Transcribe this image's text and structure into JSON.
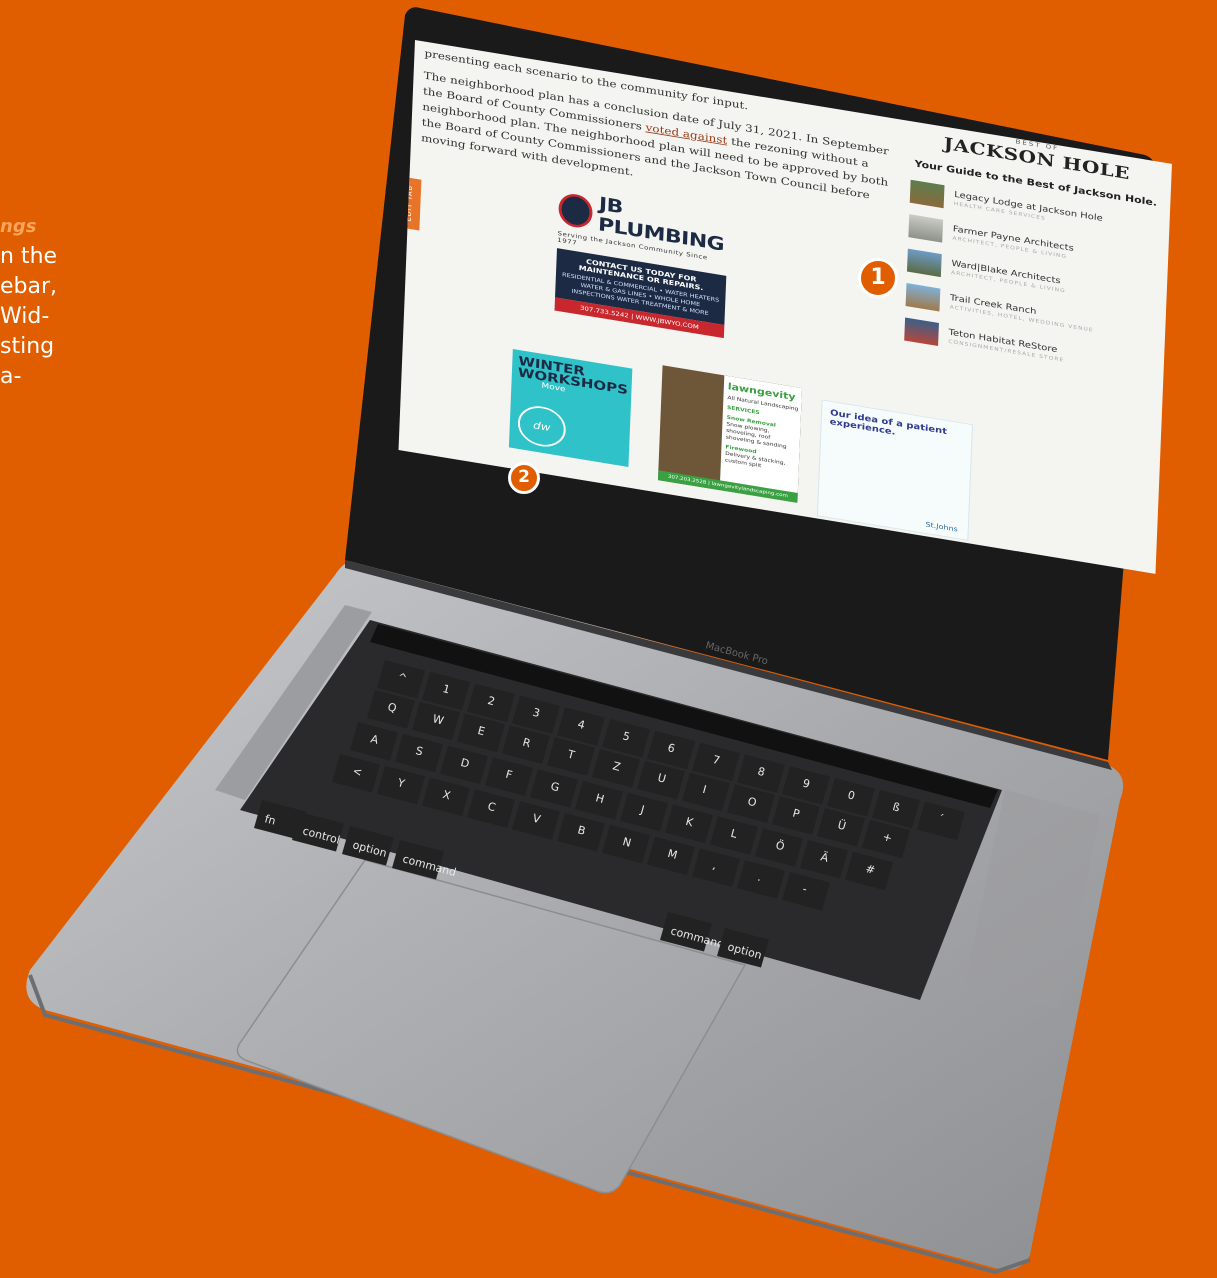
{
  "side_text": {
    "highlight": "ngs",
    "lines": [
      "n the",
      "ebar,",
      "Wid-",
      "sting",
      "a-"
    ]
  },
  "article": {
    "p1": "presenting each scenario to the community for input.",
    "p2a": "The neighborhood plan has a conclusion date of July 31, 2021. In September the Board of County Commissioners ",
    "p2_link": "voted against",
    "p2b": " the rezoning without a neighborhood plan. The neighborhood plan will need to be approved by both the Board of County Commissioners and the Jackson Town Council before moving forward with development."
  },
  "edit_tab": "EDIT TAB",
  "jb_ad": {
    "name": "JB PLUMBING",
    "tagline": "Serving the Jackson Community Since 1977",
    "cta": "CONTACT US TODAY FOR MAINTENANCE OR REPAIRS.",
    "services": "RESIDENTIAL & COMMERCIAL • WATER HEATERS WATER & GAS LINES • WHOLE HOME INSPECTIONS WATER TREATMENT & MORE",
    "phone": "307.733.5242 | WWW.JBWYO.COM"
  },
  "winter_ad": {
    "title": "WINTER WORKSHOPS",
    "sub": "Move",
    "badge": "dw"
  },
  "lawn_ad": {
    "brand": "lawngevity",
    "intro": "All Natural Landscaping",
    "s1_title": "Snow Removal",
    "s1_text": "Snow plowing, shoveling, roof shoveling & sanding",
    "s2_title": "Firewood",
    "s2_text": "Delivery & stacking, custom split",
    "footer": "307.203.2528 | lawngevitylandscaping.com",
    "services_label": "SERVICES"
  },
  "patient_ad": {
    "title": "Our idea of a patient experience.",
    "logo": "St.Johns"
  },
  "best_of": {
    "small": "BEST OF",
    "big": "JACKSON HOLE",
    "guide": "Your Guide to the Best of Jackson Hole.",
    "items": [
      {
        "name": "Legacy Lodge at Jackson Hole",
        "cat": "HEALTH CARE SERVICES"
      },
      {
        "name": "Farmer Payne Architects",
        "cat": "ARCHITECT, PEOPLE & LIVING"
      },
      {
        "name": "Ward|Blake Architects",
        "cat": "ARCHITECT, PEOPLE & LIVING"
      },
      {
        "name": "Trail Creek Ranch",
        "cat": "ACTIVITIES, HOTEL, WEDDING VENUE"
      },
      {
        "name": "Teton Habitat ReStore",
        "cat": "CONSIGNMENT/RESALE STORE"
      }
    ]
  },
  "markers": {
    "m1": "1",
    "m2": "2"
  },
  "laptop": {
    "model": "MacBook Pro"
  },
  "keyboard": {
    "row1": [
      "^",
      "1",
      "2",
      "3",
      "4",
      "5",
      "6",
      "7",
      "8",
      "9",
      "0",
      "ß",
      "´"
    ],
    "row2": [
      "Q",
      "W",
      "E",
      "R",
      "T",
      "Z",
      "U",
      "I",
      "O",
      "P",
      "Ü",
      "+"
    ],
    "row3": [
      "A",
      "S",
      "D",
      "F",
      "G",
      "H",
      "J",
      "K",
      "L",
      "Ö",
      "Ä",
      "#"
    ],
    "row4": [
      "<",
      "Y",
      "X",
      "C",
      "V",
      "B",
      "N",
      "M",
      ",",
      ".",
      "-"
    ],
    "mods": [
      "fn",
      "control",
      "option",
      "command",
      "command",
      "option"
    ]
  }
}
